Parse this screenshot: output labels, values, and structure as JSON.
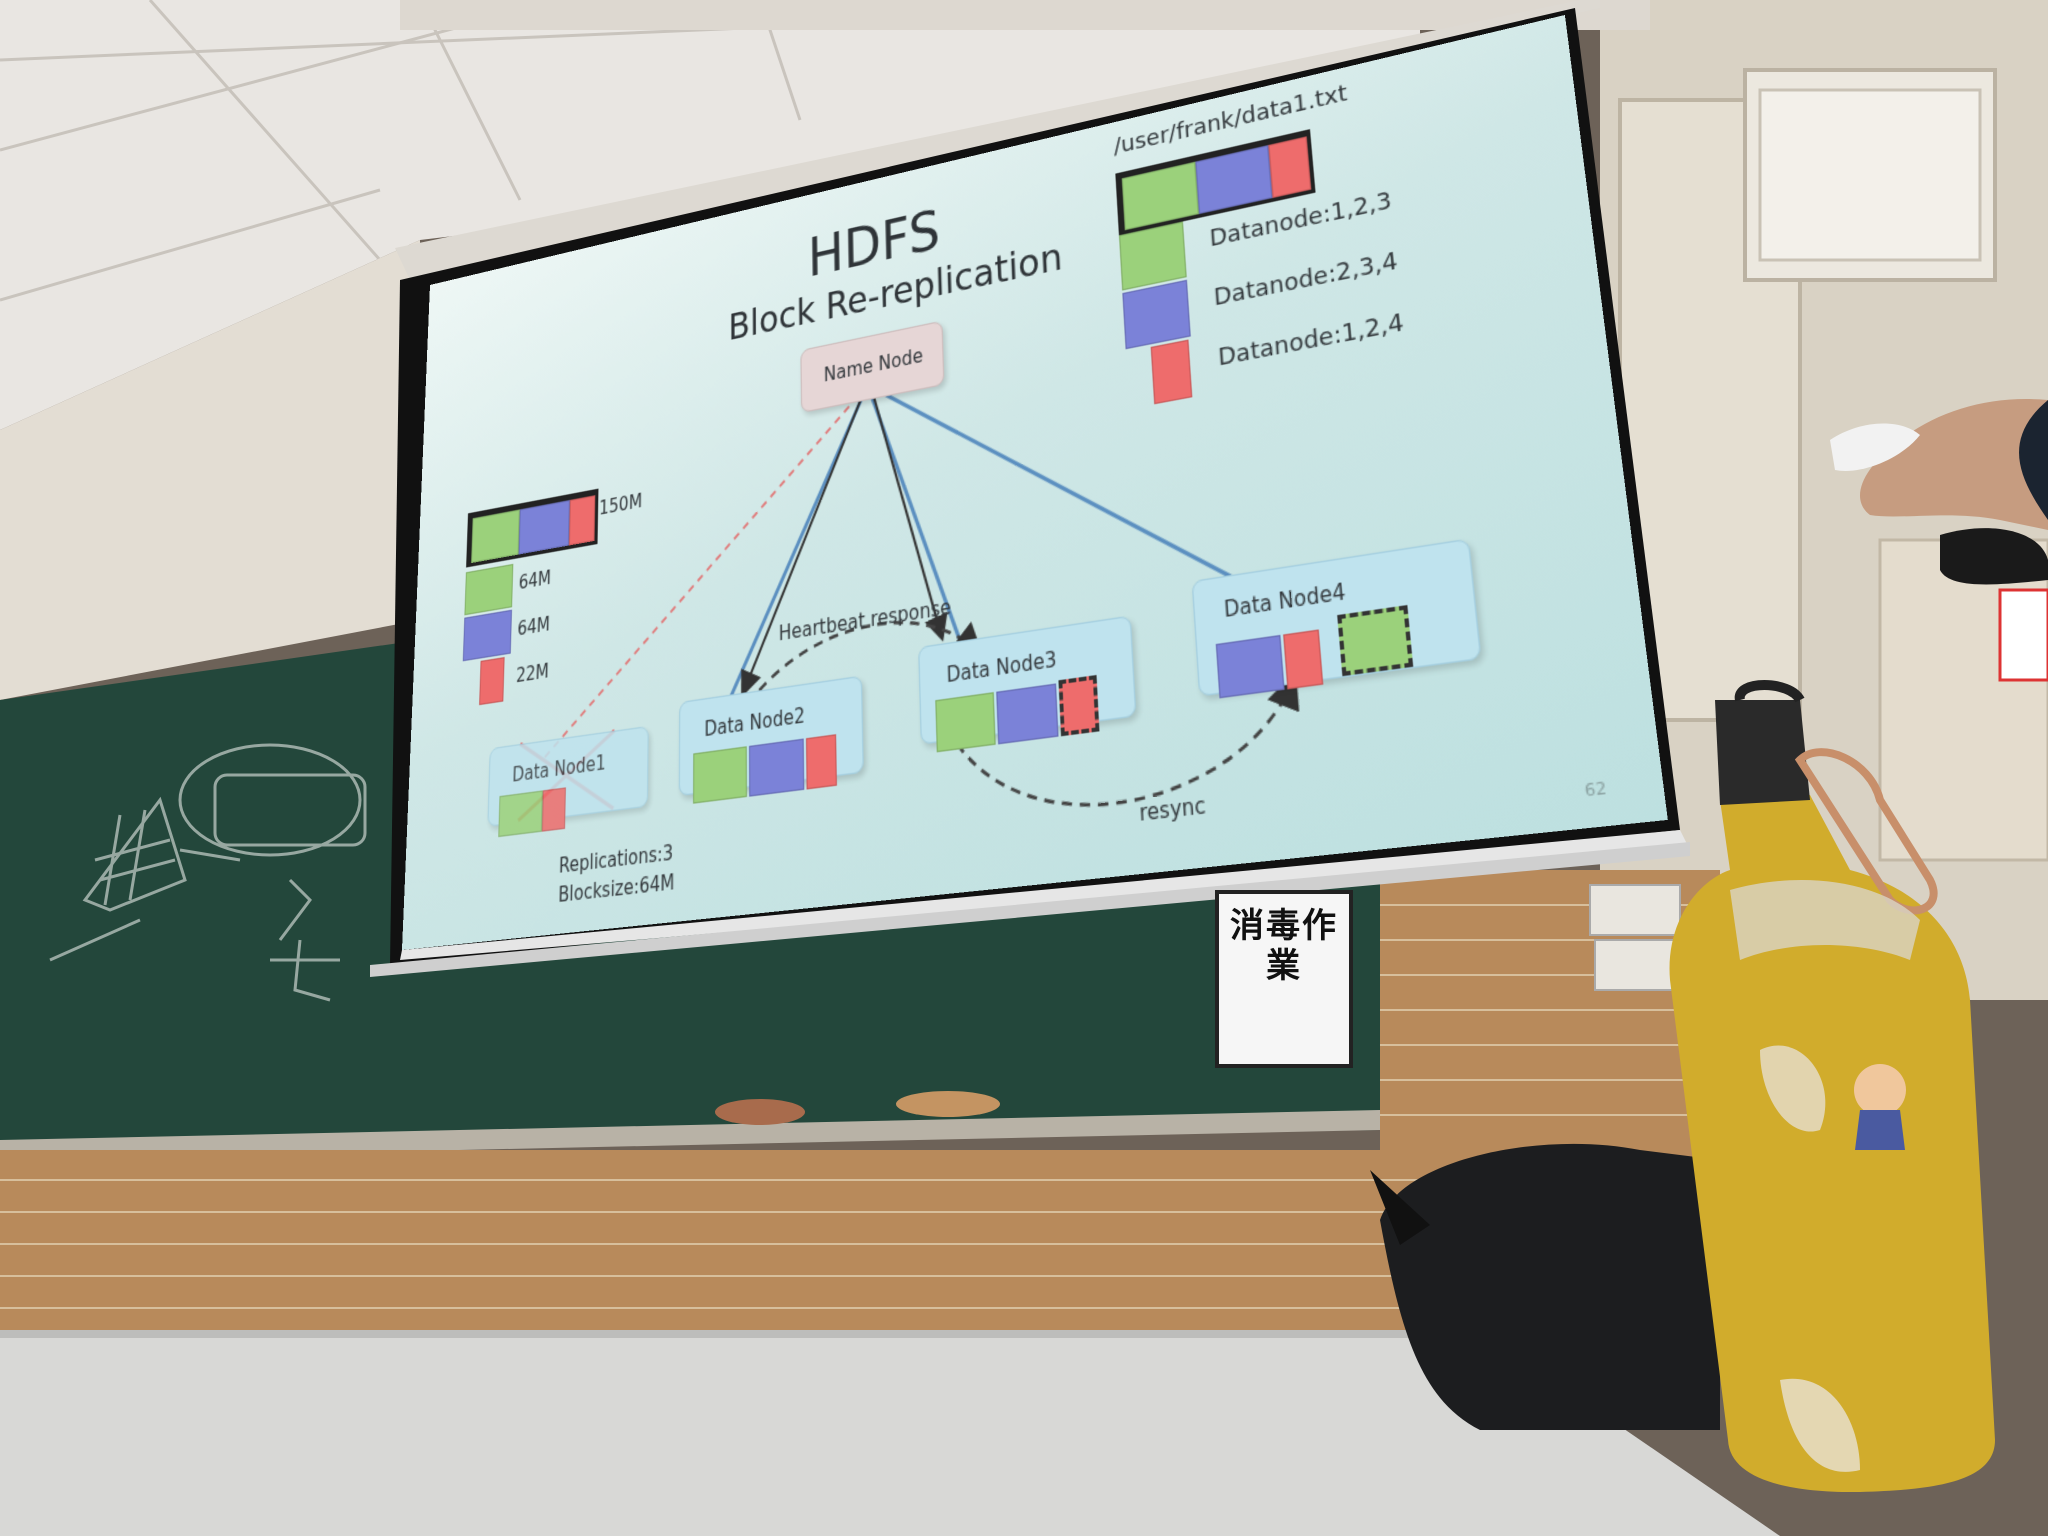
{
  "slide": {
    "title": "HDFS",
    "subtitle": "Block Re-replication",
    "file_path": "/user/frank/data1.txt",
    "name_node": "Name Node",
    "file_size": "150M",
    "block_sizes": [
      "64M",
      "64M",
      "22M"
    ],
    "block_locations": [
      "Datanode:1,2,3",
      "Datanode:2,3,4",
      "Datanode:1,2,4"
    ],
    "heartbeat_label": "Heartbeat response",
    "data_nodes": [
      "Data Node1",
      "Data Node2",
      "Data Node3",
      "Data Node4"
    ],
    "resync_label": "resync",
    "replications": "Replications:3",
    "blocksize": "Blocksize:64M",
    "page_number": "62",
    "colors": {
      "block_green": "#9bd17b",
      "block_purple": "#7b82d8",
      "block_red": "#ee6c6c",
      "node_fill": "#bfe3ee"
    }
  },
  "wall_sign": "消毒作業"
}
